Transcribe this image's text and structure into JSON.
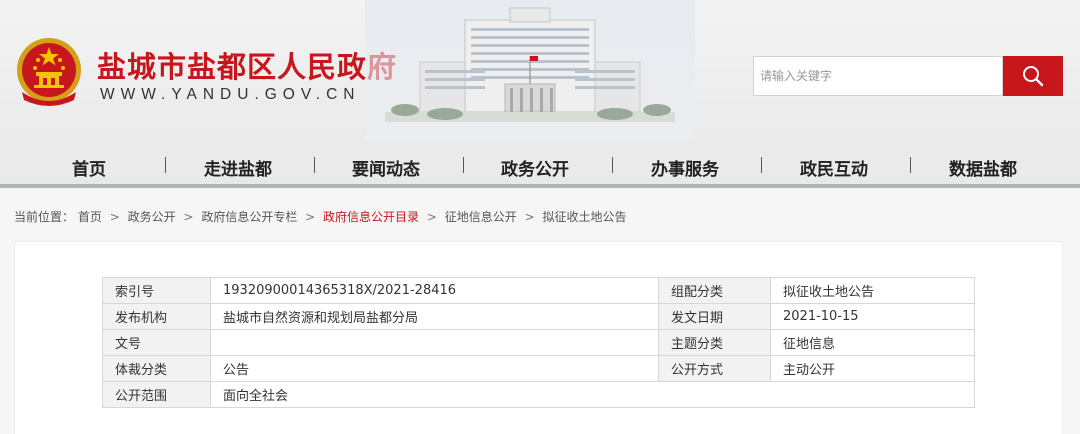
{
  "header": {
    "site_title": "盐城市盐都区人民政府",
    "site_url": "WWW.YANDU.GOV.CN",
    "search": {
      "placeholder": "请输入关键字"
    },
    "brand_color": "#c8161d"
  },
  "nav": {
    "items": [
      "首页",
      "走进盐都",
      "要闻动态",
      "政务公开",
      "办事服务",
      "政民互动",
      "数据盐都"
    ]
  },
  "breadcrumb": {
    "label": "当前位置：",
    "items": [
      "首页",
      "政务公开",
      "政府信息公开专栏",
      "政府信息公开目录",
      "征地信息公开",
      "拟征收土地公告"
    ],
    "separator": ">"
  },
  "meta": {
    "rows": [
      {
        "k1": "索引号",
        "v1": "19320900014365318X/2021-28416",
        "k2": "组配分类",
        "v2": "拟征收土地公告"
      },
      {
        "k1": "发布机构",
        "v1": "盐城市自然资源和规划局盐都分局",
        "k2": "发文日期",
        "v2": "2021-10-15"
      },
      {
        "k1": "文号",
        "v1": "",
        "k2": "主题分类",
        "v2": "征地信息"
      },
      {
        "k1": "体裁分类",
        "v1": "公告",
        "k2": "公开方式",
        "v2": "主动公开"
      },
      {
        "k1": "公开范围",
        "v1": "面向全社会"
      }
    ]
  }
}
